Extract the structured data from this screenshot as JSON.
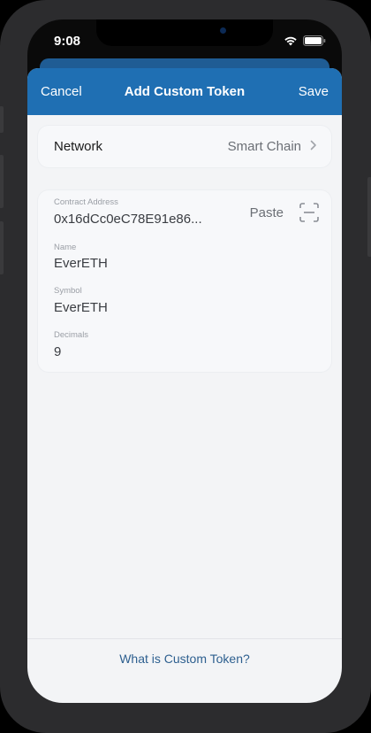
{
  "status_bar": {
    "time": "9:08"
  },
  "navbar": {
    "cancel_label": "Cancel",
    "title": "Add Custom Token",
    "save_label": "Save"
  },
  "network": {
    "label": "Network",
    "value": "Smart Chain"
  },
  "form": {
    "contract_address": {
      "label": "Contract Address",
      "value": "0x16dCc0eC78E91e86...",
      "paste_label": "Paste"
    },
    "name": {
      "label": "Name",
      "value": "EverETH"
    },
    "symbol": {
      "label": "Symbol",
      "value": "EverETH"
    },
    "decimals": {
      "label": "Decimals",
      "value": "9"
    }
  },
  "footer": {
    "link_text": "What is Custom Token?"
  },
  "colors": {
    "navbar": "#1f6fb3",
    "background": "#f3f4f6",
    "link": "#2d5f8f"
  }
}
